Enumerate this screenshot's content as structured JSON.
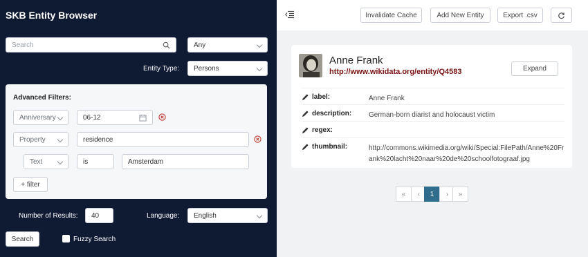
{
  "app": {
    "title": "SKB Entity Browser"
  },
  "search": {
    "placeholder": "Search",
    "scope_value": "Any"
  },
  "entity_type": {
    "label": "Entity Type:",
    "value": "Persons"
  },
  "advanced": {
    "title": "Advanced Filters:",
    "filter1": {
      "type": "Anniversary",
      "value": "06-12"
    },
    "filter2": {
      "type": "Property",
      "value": "residence"
    },
    "filter3": {
      "kind": "Text",
      "op": "is",
      "value": "Amsterdam"
    },
    "add_filter_label": "+ filter"
  },
  "results": {
    "label": "Number of Results:",
    "value": "40"
  },
  "language": {
    "label": "Language:",
    "value": "English"
  },
  "search_button_label": "Search",
  "fuzzy_label": "Fuzzy Search",
  "toolbar": {
    "invalidate_label": "Invalidate Cache",
    "add_label": "Add New Entity",
    "export_label": "Export .csv"
  },
  "entity": {
    "name": "Anne Frank",
    "url": "http://www.wikidata.org/entity/Q4583",
    "expand_label": "Expand",
    "fields": [
      {
        "key": "label:",
        "value": "Anne Frank"
      },
      {
        "key": "description:",
        "value": "German-born diarist and holocaust victim"
      },
      {
        "key": "regex:",
        "value": ""
      },
      {
        "key": "thumbnail:",
        "value": "http://commons.wikimedia.org/wiki/Special:FilePath/Anne%20Frank%20lacht%20naar%20de%20schoolfotograaf.jpg"
      }
    ]
  },
  "pagination": {
    "first": "«",
    "prev": "‹",
    "current": "1",
    "next": "›",
    "last": "»"
  },
  "colors": {
    "sidebar_bg": "#0f1a33",
    "link": "#7a1212",
    "page_active": "#2f6d8c",
    "remove_icon": "#c0392b"
  }
}
